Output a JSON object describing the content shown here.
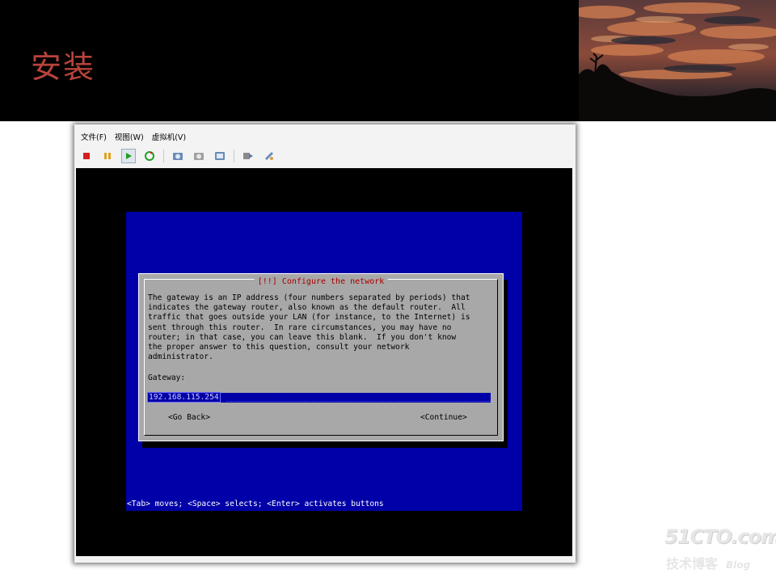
{
  "slide": {
    "title": "安装"
  },
  "vm": {
    "menu": [
      "文件(F)",
      "视图(W)",
      "虚拟机(V)"
    ],
    "toolbar_icons": [
      "stop-icon",
      "pause-icon",
      "play-icon",
      "reset-icon",
      "snapshot-icon",
      "revert-snapshot-icon",
      "snapshot-manager-icon",
      "send-ctrl-alt-del-icon",
      "settings-icon"
    ]
  },
  "installer": {
    "dialog_title": "[!!] Configure the network",
    "description": "The gateway is an IP address (four numbers separated by periods) that\nindicates the gateway router, also known as the default router.  All\ntraffic that goes outside your LAN (for instance, to the Internet) is\nsent through this router.  In rare circumstances, you may have no\nrouter; in that case, you can leave this blank.  If you don't know\nthe proper answer to this question, consult your network\nadministrator.",
    "gateway_label": "Gateway:",
    "gateway_value": "192.168.115.254",
    "go_back": "<Go Back>",
    "continue": "<Continue>",
    "status_line": "<Tab> moves; <Space> selects; <Enter> activates buttons"
  },
  "watermark": {
    "main": "51CTO.com",
    "sub": "技术博客",
    "blog": "Blog"
  },
  "colors": {
    "installer_blue": "#0000a8",
    "dialog_gray": "#a8a8a8",
    "title_red": "#b8433b"
  }
}
